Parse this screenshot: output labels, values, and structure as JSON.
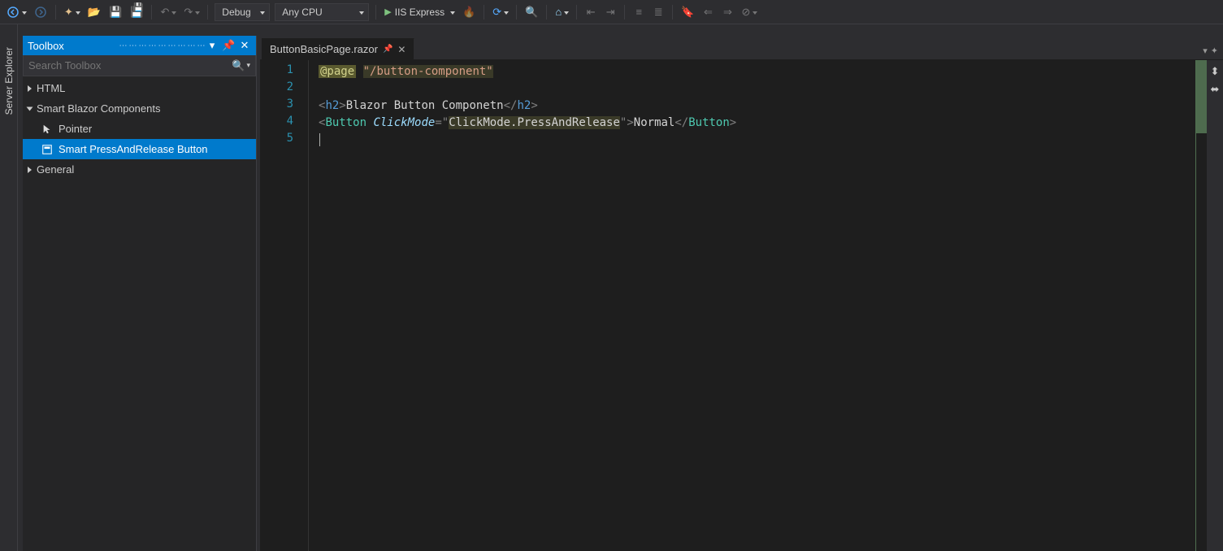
{
  "toolbar": {
    "config_dropdown": "Debug",
    "platform_dropdown": "Any CPU",
    "run_target": "IIS Express"
  },
  "sidebar_rail": {
    "tab1": "Server Explorer"
  },
  "toolbox": {
    "title": "Toolbox",
    "search_placeholder": "Search Toolbox",
    "groups": {
      "html": "HTML",
      "smart": "Smart Blazor Components",
      "general": "General"
    },
    "items": {
      "pointer": "Pointer",
      "smart_btn": "Smart PressAndRelease Button"
    }
  },
  "editor": {
    "tab_name": "ButtonBasicPage.razor",
    "lines": {
      "l1": "1",
      "l2": "2",
      "l3": "3",
      "l4": "4",
      "l5": "5"
    },
    "code": {
      "l1_page": "@page",
      "l1_str": "\"/button-component\"",
      "l3_open_b": "<",
      "l3_h2": "h2",
      "l3_close_b": ">",
      "l3_text": "Blazor Button Componetn",
      "l3_close_open": "</",
      "l4_open_b": "<",
      "l4_button": "Button",
      "l4_space": " ",
      "l4_attr": "ClickMode",
      "l4_eq": "=",
      "l4_attrq": "\"",
      "l4_attrval": "ClickMode.PressAndRelease",
      "l4_close_b": ">",
      "l4_text": "Normal",
      "l4_close_open": "</"
    }
  }
}
